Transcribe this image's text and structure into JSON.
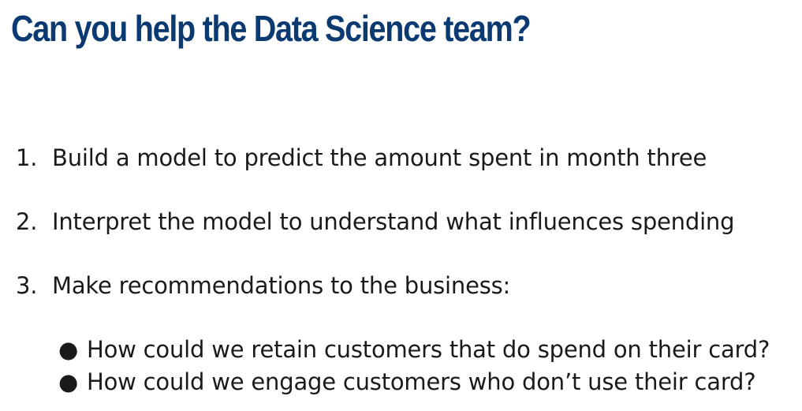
{
  "title": "Can you help the Data Science team?",
  "steps": [
    {
      "number": "1.",
      "text": "Build a model to predict the amount spent in month three"
    },
    {
      "number": "2.",
      "text": "Interpret the model to understand what influences spending"
    },
    {
      "number": "3.",
      "text": "Make recommendations to the business:"
    }
  ],
  "bullets": [
    {
      "marker": "●",
      "text": "How could we retain customers that do spend on their card?"
    },
    {
      "marker": "●",
      "text": "How could we engage customers who don’t use their card?"
    }
  ],
  "colors": {
    "title": "#0b3a72",
    "text": "#1a1a1a",
    "background": "#ffffff"
  }
}
